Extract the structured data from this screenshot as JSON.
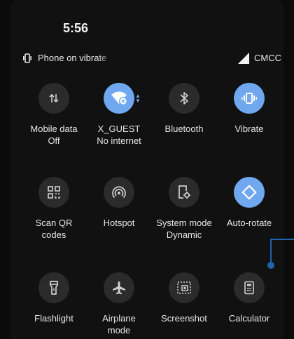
{
  "status": {
    "time": "5:56",
    "notification": "Phone on vibrate",
    "carrier": "CMCC"
  },
  "tiles": [
    {
      "name": "mobile-data",
      "label": "Mobile data",
      "sub": "Off",
      "icon": "mobile-data-icon",
      "active": false
    },
    {
      "name": "wifi",
      "label": "X_GUEST",
      "sub": "No internet",
      "icon": "wifi-no-internet-icon",
      "active": true
    },
    {
      "name": "bluetooth",
      "label": "Bluetooth",
      "sub": "",
      "icon": "bluetooth-icon",
      "active": false
    },
    {
      "name": "vibrate",
      "label": "Vibrate",
      "sub": "",
      "icon": "vibrate-icon",
      "active": true
    },
    {
      "name": "scan-qr",
      "label": "Scan QR",
      "sub": "codes",
      "icon": "qr-code-icon",
      "active": false
    },
    {
      "name": "hotspot",
      "label": "Hotspot",
      "sub": "",
      "icon": "hotspot-icon",
      "active": false
    },
    {
      "name": "system-mode",
      "label": "System mode",
      "sub": "Dynamic",
      "icon": "system-mode-icon",
      "active": false
    },
    {
      "name": "auto-rotate",
      "label": "Auto-rotate",
      "sub": "",
      "icon": "auto-rotate-icon",
      "active": true
    },
    {
      "name": "flashlight",
      "label": "Flashlight",
      "sub": "",
      "icon": "flashlight-icon",
      "active": false
    },
    {
      "name": "airplane",
      "label": "Airplane",
      "sub": "mode",
      "icon": "airplane-icon",
      "active": false
    },
    {
      "name": "screenshot",
      "label": "Screenshot",
      "sub": "",
      "icon": "screenshot-icon",
      "active": false
    },
    {
      "name": "calculator",
      "label": "Calculator",
      "sub": "",
      "icon": "calculator-icon",
      "active": false
    }
  ],
  "colors": {
    "active": "#6fa8ee",
    "inactive": "#2b2b2b",
    "callout": "#1f63a8"
  }
}
